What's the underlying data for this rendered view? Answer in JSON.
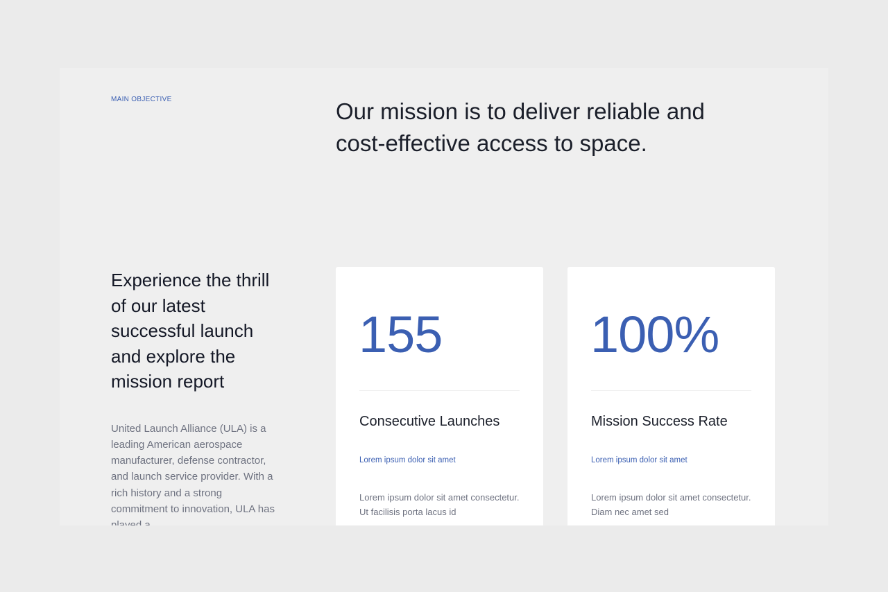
{
  "section": {
    "eyebrow": "MAIN OBJECTIVE",
    "mission": "Our mission is to deliver reliable and cost-effective access to space."
  },
  "intro": {
    "heading": "Experience the thrill of our latest successful launch and explore the mission report",
    "body": "United Launch Alliance (ULA) is a leading American aerospace manufacturer, defense contractor, and launch service provider. With a rich history and a strong commitment to innovation, ULA has played a"
  },
  "cards": [
    {
      "stat": "155",
      "title": "Consecutive Launches",
      "link": "Lorem ipsum dolor sit amet",
      "body": "Lorem ipsum dolor sit amet consectetur. Ut facilisis porta lacus id"
    },
    {
      "stat": "100%",
      "title": "Mission Success Rate",
      "link": "Lorem ipsum dolor sit amet",
      "body": "Lorem ipsum dolor sit amet consectetur. Diam nec amet sed"
    }
  ],
  "colors": {
    "accent": "#3b5fb2",
    "heading": "#1b1f2a",
    "body_text": "#6e7280",
    "page_bg": "#ebebeb",
    "card_bg": "#ffffff"
  }
}
